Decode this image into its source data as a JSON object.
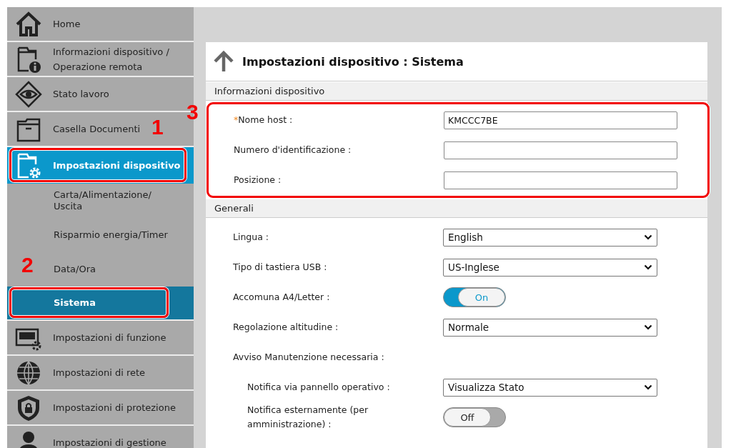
{
  "sidebar": {
    "items": [
      {
        "label": "Home",
        "selected": false,
        "highlighted": false
      },
      {
        "label": "Informazioni dispositivo / Operazione remota",
        "selected": false,
        "highlighted": false
      },
      {
        "label": "Stato lavoro",
        "selected": false,
        "highlighted": false
      },
      {
        "label": "Casella Documenti",
        "selected": false,
        "highlighted": false
      },
      {
        "label": "Impostazioni dispositivo",
        "selected": true,
        "highlighted": true,
        "callout": "1",
        "children": [
          {
            "label": "Carta/Alimentazione/ Uscita",
            "selected": false,
            "highlighted": false
          },
          {
            "label": "Risparmio energia/Timer",
            "selected": false,
            "highlighted": false
          },
          {
            "label": "Data/Ora",
            "selected": false,
            "highlighted": false
          },
          {
            "label": "Sistema",
            "selected": true,
            "highlighted": true,
            "callout": "2"
          }
        ]
      },
      {
        "label": "Impostazioni di funzione",
        "selected": false,
        "highlighted": false
      },
      {
        "label": "Impostazioni di rete",
        "selected": false,
        "highlighted": false
      },
      {
        "label": "Impostazioni di protezione",
        "selected": false,
        "highlighted": false
      },
      {
        "label": "Impostazioni di gestione",
        "selected": false,
        "highlighted": false
      }
    ]
  },
  "page": {
    "title": "Impostazioni dispositivo : Sistema",
    "sections": [
      {
        "title": "Informazioni dispositivo",
        "highlighted": true,
        "callout": "3",
        "rows": [
          {
            "kind": "text",
            "label": "Nome host :",
            "required_mark": "*",
            "value": "KMCCC7BE"
          },
          {
            "kind": "text",
            "label": "Numero d'identificazione :",
            "value": ""
          },
          {
            "kind": "text",
            "label": "Posizione :",
            "value": ""
          }
        ]
      },
      {
        "title": "Generali",
        "highlighted": false,
        "rows": [
          {
            "kind": "select",
            "label": "Lingua :",
            "value": "English"
          },
          {
            "kind": "select",
            "label": "Tipo di tastiera USB :",
            "value": "US-Inglese"
          },
          {
            "kind": "toggle",
            "label": "Accomuna A4/Letter :",
            "on": true,
            "value": "On"
          },
          {
            "kind": "select",
            "label": "Regolazione altitudine :",
            "value": "Normale"
          },
          {
            "kind": "group",
            "label": "Avviso Manutenzione necessaria :",
            "children": [
              {
                "kind": "select",
                "label": "Notifica via pannello operativo :",
                "value": "Visualizza Stato"
              },
              {
                "kind": "toggle",
                "label": "Notifica esternamente (per amministrazione) :",
                "on": false,
                "value": "Off"
              }
            ]
          }
        ]
      }
    ]
  }
}
